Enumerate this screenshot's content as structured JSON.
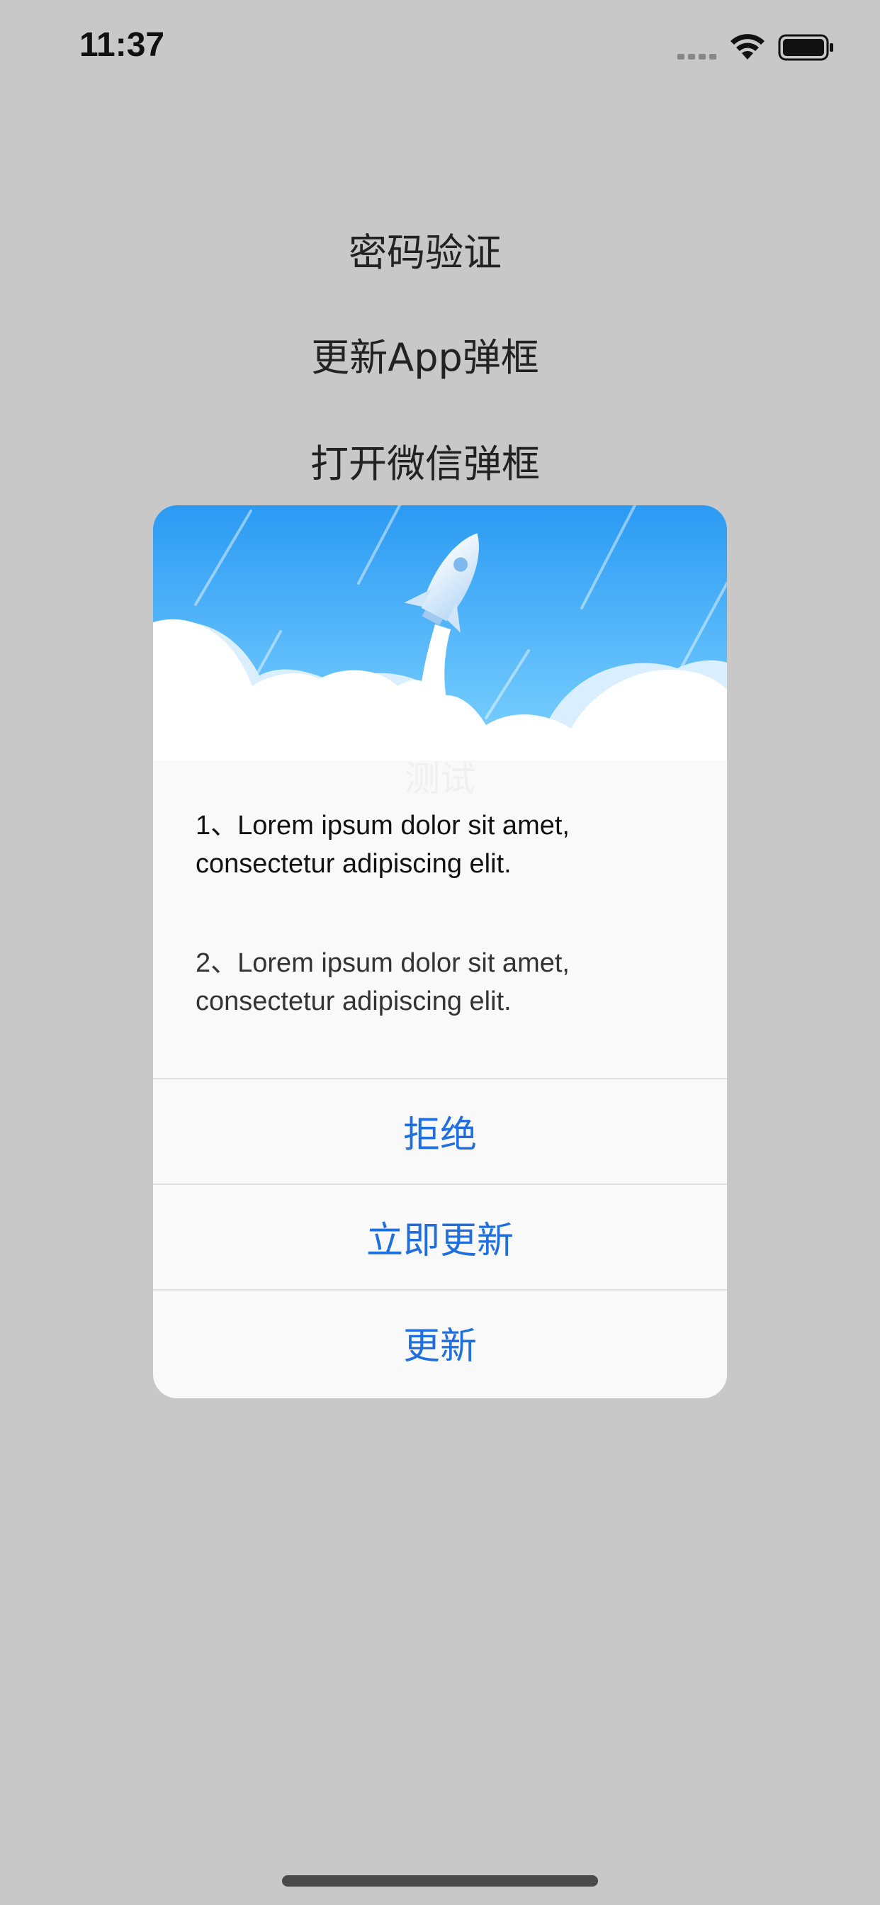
{
  "status_bar": {
    "time": "11:37",
    "icons": [
      "signal-icon",
      "wifi-icon",
      "battery-icon"
    ]
  },
  "background_menu": {
    "items": [
      {
        "label": "密码验证"
      },
      {
        "label": "更新App弹框"
      },
      {
        "label": "打开微信弹框"
      }
    ]
  },
  "dialog": {
    "header_image": "rocket-launch-illustration",
    "title": "测试",
    "content": [
      "1、Lorem ipsum dolor sit amet, consectetur adipiscing elit.",
      "2、Lorem ipsum dolor sit amet, consectetur adipiscing elit."
    ],
    "actions": [
      {
        "label": "拒绝"
      },
      {
        "label": "立即更新"
      },
      {
        "label": "更新"
      }
    ]
  },
  "colors": {
    "backdrop": "#c8c8c8",
    "dialog_bg": "#f9f9f9",
    "action_text": "#1f6fe0",
    "sky_top": "#2b9af3",
    "sky_bottom": "#7fd3ff"
  }
}
